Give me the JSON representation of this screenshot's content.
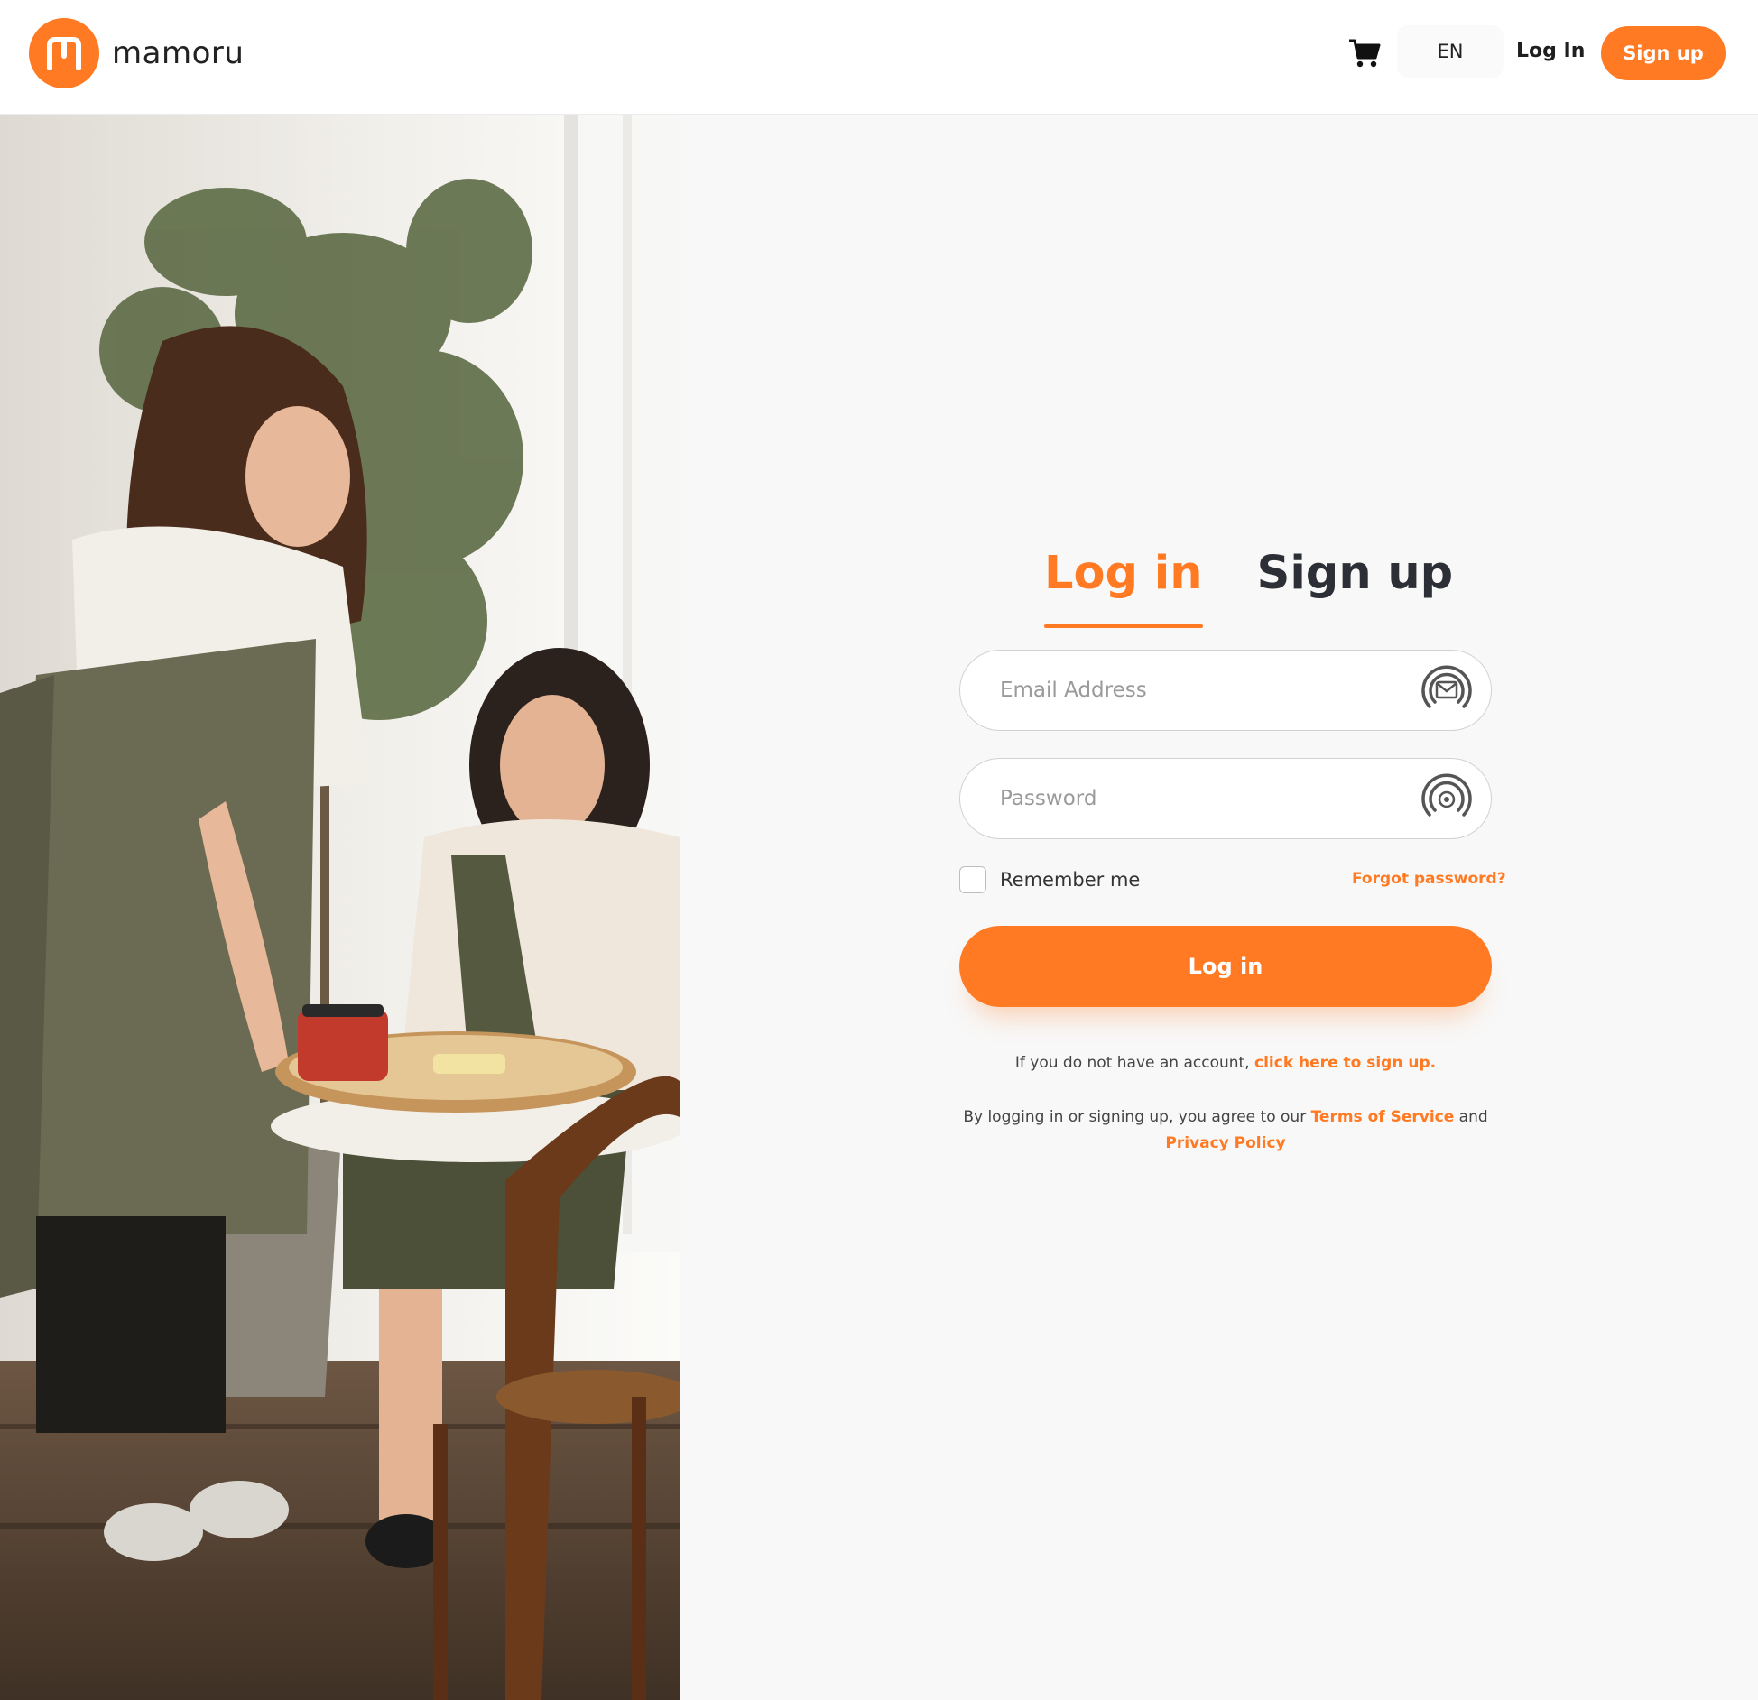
{
  "brand": {
    "name": "mamoru",
    "accent": "#ff7a22"
  },
  "header": {
    "cart_icon": "cart-icon",
    "language": "EN",
    "login_label": "Log In",
    "signup_label": "Sign up"
  },
  "form": {
    "tabs": [
      {
        "label": "Log in",
        "active": true
      },
      {
        "label": "Sign up",
        "active": false
      }
    ],
    "email": {
      "placeholder": "Email Address",
      "value": "",
      "icon": "email-icon"
    },
    "password": {
      "placeholder": "Password",
      "value": "",
      "icon": "password-icon"
    },
    "remember_label": "Remember me",
    "forgot_label": "Forgot password?",
    "submit_label": "Log in",
    "signup_prompt": "If you do not have an account,",
    "signup_link": "click here to sign up.",
    "agreement_text": "By logging in or signing up, you agree to our",
    "terms_label": "Terms of Service",
    "and_text": "and",
    "privacy_label": "Privacy Policy"
  }
}
